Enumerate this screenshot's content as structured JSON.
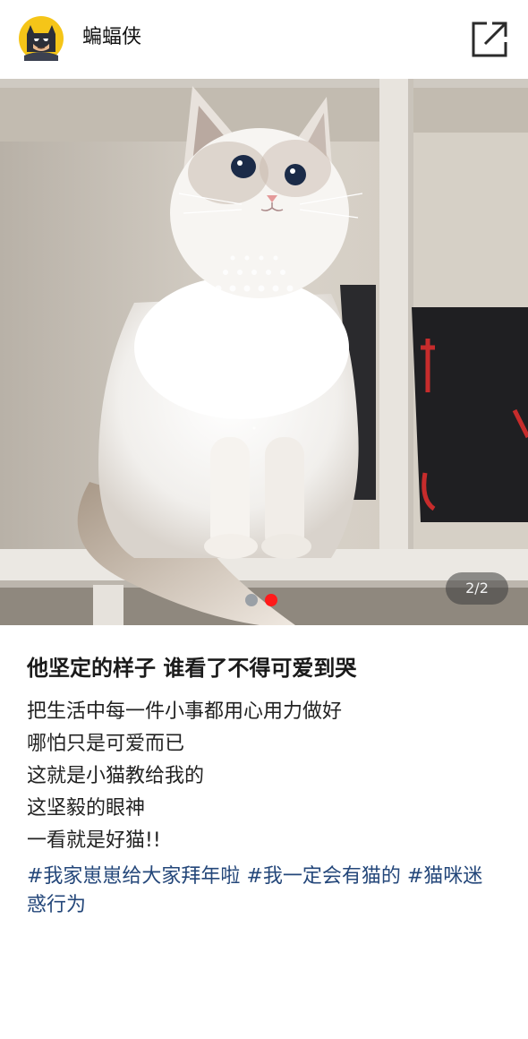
{
  "user": {
    "name": "蝙蝠侠",
    "avatar_icon": "batman-avatar-icon"
  },
  "header": {
    "share_icon": "share-external-icon"
  },
  "photo": {
    "description_icon": "cat-photo",
    "counter": "2/2",
    "page_current": 2,
    "page_total": 2,
    "colors": {
      "dot_inactive": "#9aa0a6",
      "dot_active": "#ff1a1a"
    }
  },
  "post": {
    "title": "他坚定的样子 谁看了不得可爱到哭",
    "lines": [
      "把生活中每一件小事都用心用力做好",
      "哪怕只是可爱而已",
      "这就是小猫教给我的",
      "这坚毅的眼神",
      "一看就是好猫!!"
    ],
    "tags": [
      "#我家崽崽给大家拜年啦",
      "#我一定会有猫的",
      "#猫咪迷惑行为"
    ],
    "tag_color": "#24477a"
  }
}
